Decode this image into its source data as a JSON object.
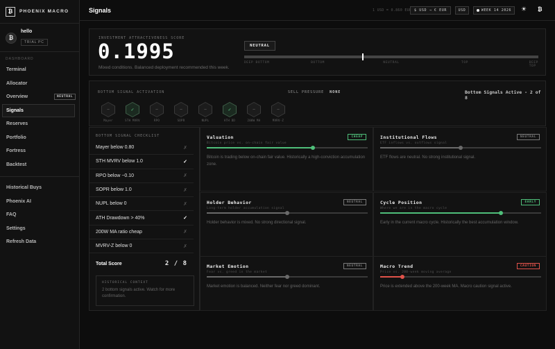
{
  "brand": {
    "name": "PHOENIX MACRO",
    "logo": "₿"
  },
  "user": {
    "avatar": "₿",
    "name": "hello",
    "plan": "TRIAL PC"
  },
  "sidebar": {
    "section_label": "DASHBOARD",
    "primary": [
      {
        "label": "Terminal"
      },
      {
        "label": "Allocator"
      },
      {
        "label": "Overview",
        "badge": "NEUTRAL"
      },
      {
        "label": "Signals",
        "active": true
      },
      {
        "label": "Reserves"
      },
      {
        "label": "Portfolio"
      },
      {
        "label": "Fortress"
      },
      {
        "label": "Backtest"
      }
    ],
    "secondary": [
      {
        "label": "Historical Buys"
      },
      {
        "label": "Phoenix AI"
      },
      {
        "label": "FAQ"
      },
      {
        "label": "Settings"
      },
      {
        "label": "Refresh Data"
      }
    ]
  },
  "header": {
    "title": "Signals",
    "fx_note": "1 USD = 0.860 EUR",
    "currency_pair": "$ USD → € EUR",
    "currency": "USD",
    "week": "WEEK 14 2026"
  },
  "score": {
    "label": "INVESTMENT ATTRACTIVENESS SCORE",
    "value": "0.1995",
    "description": "Mixed conditions. Balanced deployment recommended this week.",
    "status": "NEUTRAL",
    "marker_position": 0.4,
    "scale_labels": [
      "DEEP BOTTOM",
      "BOTTOM",
      "NEUTRAL",
      "TOP",
      "DEEP TOP"
    ]
  },
  "activation": {
    "label": "BOTTOM SIGNAL ACTIVATION",
    "sell_pressure_label": "SELL PRESSURE",
    "sell_pressure_value": "NONE",
    "active_count": "Bottom Signals Active - 2 of 8",
    "signals": [
      {
        "label": "Mayer",
        "active": false
      },
      {
        "label": "STH MVRV",
        "active": true
      },
      {
        "label": "RPO",
        "active": false
      },
      {
        "label": "SOPR",
        "active": false
      },
      {
        "label": "NUPL",
        "active": false
      },
      {
        "label": "ATH DD",
        "active": true
      },
      {
        "label": "200W MA",
        "active": false
      },
      {
        "label": "MVRV-Z",
        "active": false
      }
    ],
    "on_symbol": "✓",
    "off_symbol": "–"
  },
  "checklist": {
    "label": "BOTTOM SIGNAL CHECKLIST",
    "items": [
      {
        "label": "Mayer below 0.80",
        "met": false
      },
      {
        "label": "STH MVRV below 1.0",
        "met": true
      },
      {
        "label": "RPO below −0.10",
        "met": false
      },
      {
        "label": "SOPR below 1.0",
        "met": false
      },
      {
        "label": "NUPL below 0",
        "met": false
      },
      {
        "label": "ATH Drawdown > 40%",
        "met": true
      },
      {
        "label": "200W MA ratio cheap",
        "met": false
      },
      {
        "label": "MVRV-Z below 0",
        "met": false
      }
    ],
    "met_symbol": "✓",
    "unmet_symbol": "✗",
    "total_label": "Total Score",
    "total_value": "2 / 8",
    "context_label": "HISTORICAL CONTEXT",
    "context_text": "2 bottom signals active. Watch for more confirmation."
  },
  "cards": [
    {
      "title": "Valuation",
      "subtitle": "Bitcoin price vs. on-chain fair value",
      "badge": "CHEAP",
      "badge_color": "#4fbf7a",
      "fill": 0.66,
      "fill_color": "#4fbf7a",
      "description": "Bitcoin is trading below on-chain fair value. Historically a high-conviction accumulation zone."
    },
    {
      "title": "Institutional Flows",
      "subtitle": "ETF inflows vs. outflows signal",
      "badge": "NEUTRAL",
      "badge_color": "#7a7a7a",
      "fill": 0.5,
      "fill_color": "#6a6a6a",
      "description": "ETF flows are neutral. No strong institutional signal."
    },
    {
      "title": "Holder Behavior",
      "subtitle": "Long-term holder accumulation signal",
      "badge": "NEUTRAL",
      "badge_color": "#7a7a7a",
      "fill": 0.5,
      "fill_color": "#6a6a6a",
      "description": "Holder behavior is mixed. No strong directional signal."
    },
    {
      "title": "Cycle Position",
      "subtitle": "Where we are in the macro cycle",
      "badge": "EARLY",
      "badge_color": "#4fbf7a",
      "fill": 0.75,
      "fill_color": "#4fbf7a",
      "description": "Early in the current macro cycle. Historically the best accumulation window."
    },
    {
      "title": "Market Emotion",
      "subtitle": "Fear vs. greed in the market",
      "badge": "NEUTRAL",
      "badge_color": "#7a7a7a",
      "fill": 0.5,
      "fill_color": "#6a6a6a",
      "description": "Market emotion is balanced. Neither fear nor greed dominant."
    },
    {
      "title": "Macro Trend",
      "subtitle": "Price vs. 200-week moving average",
      "badge": "CAUTION",
      "badge_color": "#e0524a",
      "fill": 0.14,
      "fill_color": "#e0524a",
      "description": "Price is extended above the 200-week MA. Macro caution signal active."
    }
  ]
}
